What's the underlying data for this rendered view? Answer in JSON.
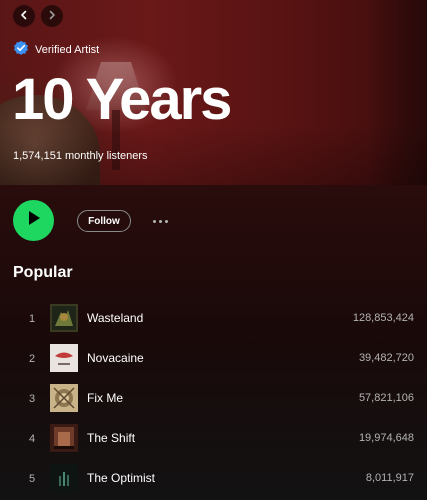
{
  "nav": {
    "back_icon": "chevron-left-icon",
    "forward_icon": "chevron-right-icon"
  },
  "artist": {
    "verified_label": "Verified Artist",
    "verified_icon": "verified-badge-icon",
    "name": "10 Years",
    "monthly_listeners": "1,574,151 monthly listeners"
  },
  "actions": {
    "play_icon": "play-icon",
    "follow_label": "Follow",
    "more_icon": "more-options-icon"
  },
  "popular": {
    "title": "Popular",
    "tracks": [
      {
        "rank": "1",
        "title": "Wasteland",
        "plays": "128,853,424"
      },
      {
        "rank": "2",
        "title": "Novacaine",
        "plays": "39,482,720"
      },
      {
        "rank": "3",
        "title": "Fix Me",
        "plays": "57,821,106"
      },
      {
        "rank": "4",
        "title": "The Shift",
        "plays": "19,974,648"
      },
      {
        "rank": "5",
        "title": "The Optimist",
        "plays": "8,011,917"
      }
    ]
  },
  "colors": {
    "accent": "#1ed760",
    "verified": "#3d91f4",
    "hero": "#5a1616",
    "background": "#121212"
  }
}
